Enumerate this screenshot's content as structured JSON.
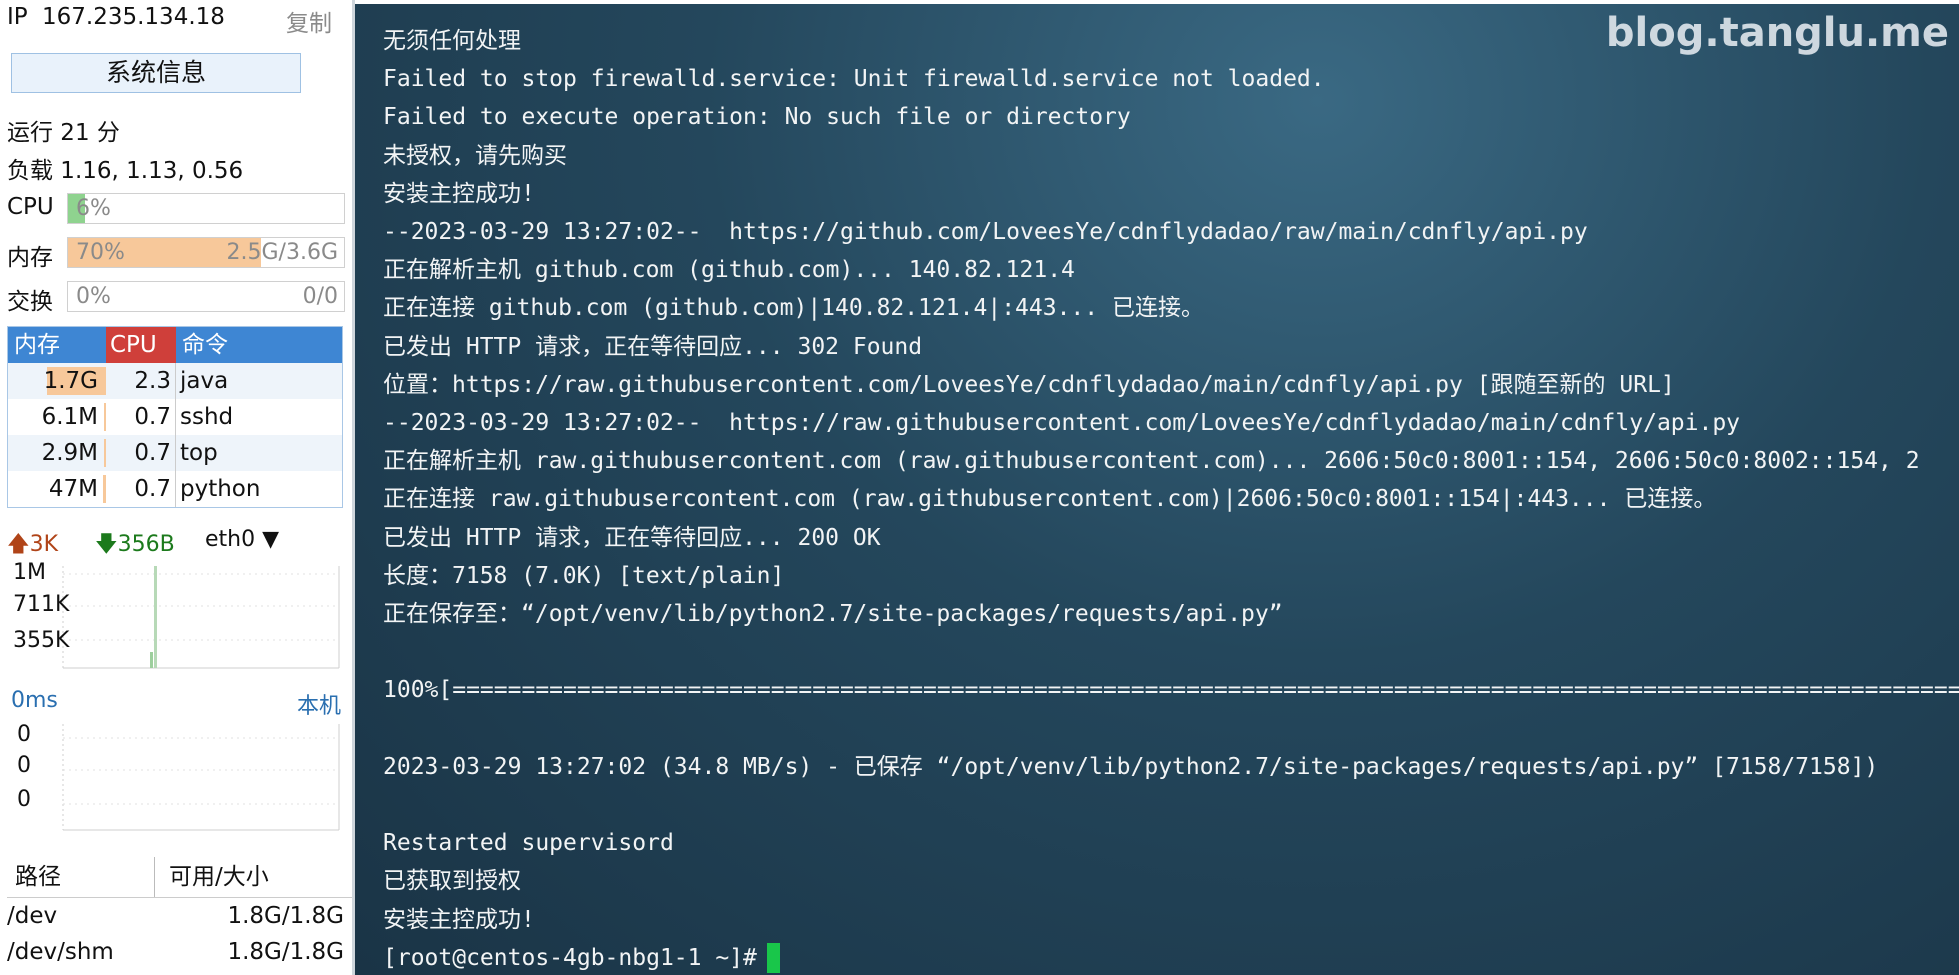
{
  "sidebar": {
    "ip_label": "IP",
    "ip_value": "167.235.134.18",
    "copy_label": "复制",
    "sysinfo_button": "系统信息",
    "uptime": "运行 21 分",
    "load": "负载 1.16, 1.13, 0.56",
    "cpu": {
      "label": "CPU",
      "percent_text": "6%",
      "percent": 6,
      "fill_color": "#8fd38f"
    },
    "memory": {
      "label": "内存",
      "percent_text": "70%",
      "percent": 70,
      "usage": "2.5G/3.6G",
      "fill_color": "#f7c89a"
    },
    "swap": {
      "label": "交换",
      "percent_text": "0%",
      "percent": 0,
      "usage": "0/0"
    },
    "process_table": {
      "headers": {
        "mem": "内存",
        "cpu": "CPU",
        "cmd": "命令"
      },
      "rows": [
        {
          "mem": "1.7G",
          "cpu": "2.3",
          "cmd": "java",
          "mem_share": 0.6
        },
        {
          "mem": "6.1M",
          "cpu": "0.7",
          "cmd": "sshd",
          "mem_share": 0.02
        },
        {
          "mem": "2.9M",
          "cpu": "0.7",
          "cmd": "top",
          "mem_share": 0.02
        },
        {
          "mem": "47M",
          "cpu": "0.7",
          "cmd": "python",
          "mem_share": 0.03
        }
      ]
    },
    "network": {
      "up": "3K",
      "down": "356B",
      "interface": "eth0",
      "y_labels": [
        "1M",
        "711K",
        "355K"
      ]
    },
    "ping": {
      "latency": "0ms",
      "host": "本机",
      "values": [
        "0",
        "0",
        "0"
      ]
    },
    "disk_table": {
      "headers": {
        "path": "路径",
        "size": "可用/大小"
      },
      "rows": [
        {
          "path": "/dev",
          "size": "1.8G/1.8G"
        },
        {
          "path": "/dev/shm",
          "size": "1.8G/1.8G"
        }
      ]
    }
  },
  "terminal": {
    "watermark": "blog.tanglu.me",
    "lines": [
      "无须任何处理",
      "Failed to stop firewalld.service: Unit firewalld.service not loaded.",
      "Failed to execute operation: No such file or directory",
      "未授权，请先购买",
      "安装主控成功!",
      "--2023-03-29 13:27:02--  https://github.com/LoveesYe/cdnflydadao/raw/main/cdnfly/api.py",
      "正在解析主机 github.com (github.com)... 140.82.121.4",
      "正在连接 github.com (github.com)|140.82.121.4|:443... 已连接。",
      "已发出 HTTP 请求，正在等待回应... 302 Found",
      "位置：https://raw.githubusercontent.com/LoveesYe/cdnflydadao/main/cdnfly/api.py [跟随至新的 URL]",
      "--2023-03-29 13:27:02--  https://raw.githubusercontent.com/LoveesYe/cdnflydadao/main/cdnfly/api.py",
      "正在解析主机 raw.githubusercontent.com (raw.githubusercontent.com)... 2606:50c0:8001::154, 2606:50c0:8002::154, 2",
      "正在连接 raw.githubusercontent.com (raw.githubusercontent.com)|2606:50c0:8001::154|:443... 已连接。",
      "已发出 HTTP 请求，正在等待回应... 200 OK",
      "长度：7158 (7.0K) [text/plain]",
      "正在保存至：“/opt/venv/lib/python2.7/site-packages/requests/api.py”",
      "",
      "100%[==================================================================================================================",
      "",
      "2023-03-29 13:27:02 (34.8 MB/s) - 已保存 “/opt/venv/lib/python2.7/site-packages/requests/api.py” [7158/7158])",
      "",
      "Restarted supervisord",
      "已获取到授权",
      "安装主控成功!"
    ],
    "prompt": "[root@centos-4gb-nbg1-1 ~]#"
  }
}
